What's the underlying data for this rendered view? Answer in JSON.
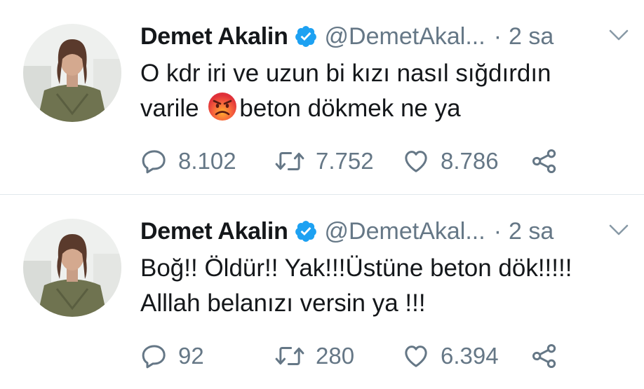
{
  "tweets": [
    {
      "name": "Demet Akalin",
      "handle": "@DemetAkal...",
      "dot": "·",
      "time": "2 sa",
      "text_line1": "O kdr iri ve uzun bi kızı nasıl sığdırdın",
      "text_line2_before": "varile ",
      "emoji": "angry-face",
      "text_line2_after": "beton dökmek ne ya",
      "replies": "8.102",
      "retweets": "7.752",
      "likes": "8.786"
    },
    {
      "name": "Demet Akalin",
      "handle": "@DemetAkal...",
      "dot": "·",
      "time": "2 sa",
      "text_line1": "Boğ!! Öldür!! Yak!!!Üstüne beton dök!!!!!",
      "text_line2": "Alllah belanızı versin ya !!!",
      "replies": "92",
      "retweets": "280",
      "likes": "6.394"
    }
  ],
  "colors": {
    "text": "#14171a",
    "secondary": "#657786",
    "verified": "#1da1f2",
    "divider": "#e1e8ed"
  },
  "icons": {
    "verified": "verified-badge-icon",
    "caret": "chevron-down-icon",
    "reply": "reply-icon",
    "retweet": "retweet-icon",
    "like": "heart-icon",
    "share": "share-icon"
  }
}
